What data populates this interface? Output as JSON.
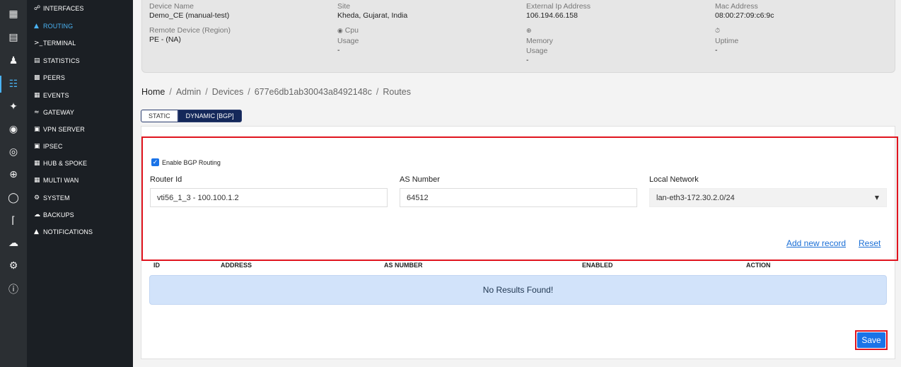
{
  "rail": {
    "icons": [
      "grid-icon",
      "store-icon",
      "users-icon",
      "router-icon",
      "network-icon",
      "radar-icon",
      "target-icon",
      "crosshair-icon",
      "globe-icon",
      "antenna-icon",
      "cloud-icon",
      "gear-icon",
      "info-icon"
    ]
  },
  "submenu": {
    "items": [
      {
        "label": "INTERFACES",
        "icon": "link-icon"
      },
      {
        "label": "ROUTING",
        "icon": "routing-icon"
      },
      {
        "label": "TERMINAL",
        "icon": "terminal-icon"
      },
      {
        "label": "STATISTICS",
        "icon": "bar-chart-icon"
      },
      {
        "label": "PEERS",
        "icon": "peers-icon"
      },
      {
        "label": "EVENTS",
        "icon": "calendar-icon"
      },
      {
        "label": "GATEWAY",
        "icon": "wifi-icon"
      },
      {
        "label": "VPN SERVER",
        "icon": "vpn-icon"
      },
      {
        "label": "IPSEC",
        "icon": "lock-icon"
      },
      {
        "label": "HUB & SPOKE",
        "icon": "hub-icon"
      },
      {
        "label": "MULTI WAN",
        "icon": "multiwan-icon"
      },
      {
        "label": "SYSTEM",
        "icon": "gear-icon"
      },
      {
        "label": "BACKUPS",
        "icon": "cloud-upload-icon"
      },
      {
        "label": "NOTIFICATIONS",
        "icon": "bell-icon"
      }
    ]
  },
  "device": {
    "device_name_label": "Device Name",
    "device_name": "Demo_CE (manual-test)",
    "site_label": "Site",
    "site": "Kheda, Gujarat, India",
    "external_ip_label": "External Ip Address",
    "external_ip": "106.194.66.158",
    "mac_label": "Mac Address",
    "mac": "08:00:27:09:c6:9c",
    "remote_label": "Remote Device (Region)",
    "remote": "PE - (NA)",
    "cpu_label": "Cpu",
    "cpu_usage_label": "Usage",
    "cpu_usage": "-",
    "memory_label": "Memory",
    "memory_usage_label": "Usage",
    "memory_usage": "-",
    "uptime_label": "Uptime",
    "uptime": "-"
  },
  "breadcrumb": {
    "home": "Home",
    "admin": "Admin",
    "devices": "Devices",
    "device_id": "677e6db1ab30043a8492148c",
    "routes": "Routes",
    "sep": "/"
  },
  "tabs": {
    "static": "STATIC",
    "dynamic": "DYNAMIC [BGP]"
  },
  "form": {
    "enable_bgp_label": "Enable BGP Routing",
    "router_id_label": "Router Id",
    "router_id_value": "vti56_1_3 - 100.100.1.2",
    "as_number_label": "AS Number",
    "as_number_value": "64512",
    "local_network_label": "Local Network",
    "local_network_value": "lan-eth3-172.30.2.0/24",
    "add_new_record": "Add new record",
    "reset": "Reset"
  },
  "table": {
    "headers": [
      "ID",
      "ADDRESS",
      "AS NUMBER",
      "ENABLED",
      "ACTION"
    ],
    "empty_message": "No Results Found!"
  },
  "save_label": "Save",
  "colors": {
    "accent": "#1a73e8",
    "highlight": "#e0141e",
    "nav_active": "#4ab3f4"
  }
}
